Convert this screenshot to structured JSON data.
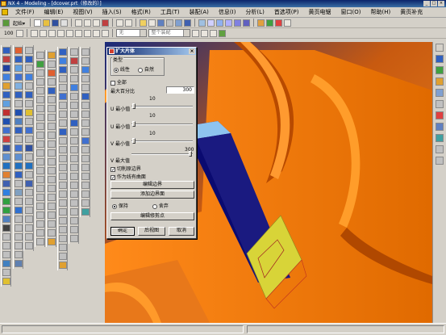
{
  "window": {
    "title": "NX 4 - Modeling - [dcover.prt（修改的）]",
    "min": "_",
    "max": "□",
    "close": "×"
  },
  "menu": [
    "文件(F)",
    "编辑(E)",
    "视图(V)",
    "插入(S)",
    "格式(R)",
    "工具(T)",
    "装配(A)",
    "信息(I)",
    "分析(L)",
    "首选项(P)",
    "黄页电锯",
    "窗口(O)",
    "帮助(H)",
    "黄页补充"
  ],
  "toolbar1": {
    "start_label": "起始▾"
  },
  "toolbar3": {
    "zoom_value": "100",
    "layer_value": "无",
    "filter_value": "整个装配"
  },
  "dialog": {
    "title": "扩大片体",
    "close": "×",
    "type_label": "类型",
    "type_linear": "线性",
    "type_natural": "自然",
    "all_label": "全部",
    "max_percent_label": "最大百分比",
    "max_percent_value": "300",
    "u_min_scale": "10",
    "u_min_label": "U 最小值",
    "u_max_scale": "10",
    "u_max_label": "U 最小值",
    "v_min_scale": "10",
    "v_min_label": "V 最小值",
    "v_max_scale": "300",
    "v_max_label": "V 最大值",
    "trim_boundary_label": "切削原边界",
    "as_curved_label": "作为线有曲面",
    "edit_boundary": "编辑边界",
    "add_boundary": "添加边界面",
    "keep_label": "保持",
    "discard_label": "舍弃",
    "edit_trim": "编辑修剪点",
    "ok": "确定",
    "back": "后视图",
    "cancel": "取消"
  },
  "colors": {
    "orange": "#f07a10",
    "dark_orange": "#a03a00",
    "navy": "#0a0a70",
    "light_blue": "#8ec4ef",
    "yellow_sheet": "#d8d438"
  }
}
